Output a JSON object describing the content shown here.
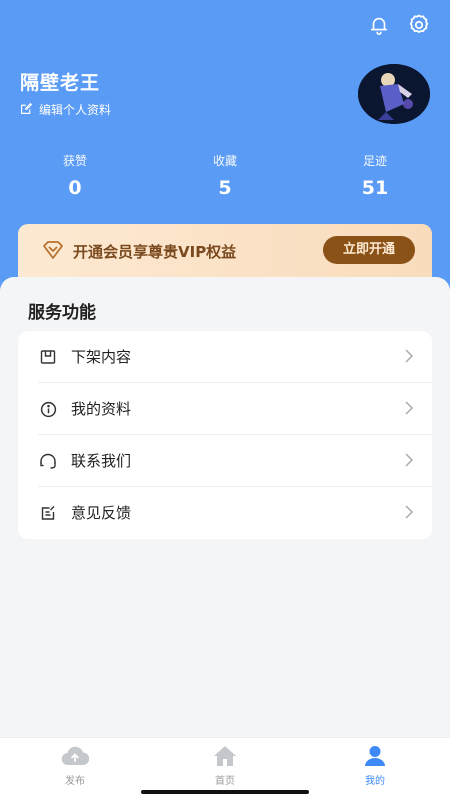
{
  "header": {
    "username": "隔壁老王",
    "edit_profile_label": "编辑个人资料",
    "icons": [
      "bell-icon",
      "gear-icon"
    ]
  },
  "stats": [
    {
      "label": "获赞",
      "value": "0"
    },
    {
      "label": "收藏",
      "value": "5"
    },
    {
      "label": "足迹",
      "value": "51"
    }
  ],
  "vip": {
    "text": "开通会员享尊贵VIP权益",
    "button_label": "立即开通",
    "icon": "diamond-icon"
  },
  "services": {
    "title": "服务功能",
    "items": [
      {
        "label": "下架内容",
        "icon": "box-icon"
      },
      {
        "label": "我的资料",
        "icon": "info-icon"
      },
      {
        "label": "联系我们",
        "icon": "headset-icon"
      },
      {
        "label": "意见反馈",
        "icon": "feedback-icon"
      }
    ]
  },
  "bottom_nav": {
    "items": [
      {
        "label": "发布",
        "icon": "cloud-upload-icon",
        "active": false
      },
      {
        "label": "首页",
        "icon": "home-icon",
        "active": false
      },
      {
        "label": "我的",
        "icon": "user-icon",
        "active": true
      }
    ]
  },
  "colors": {
    "header_bg": "#5a9bf5",
    "vip_button": "#8a5216",
    "nav_active": "#3d8af7",
    "nav_inactive": "#999999"
  }
}
